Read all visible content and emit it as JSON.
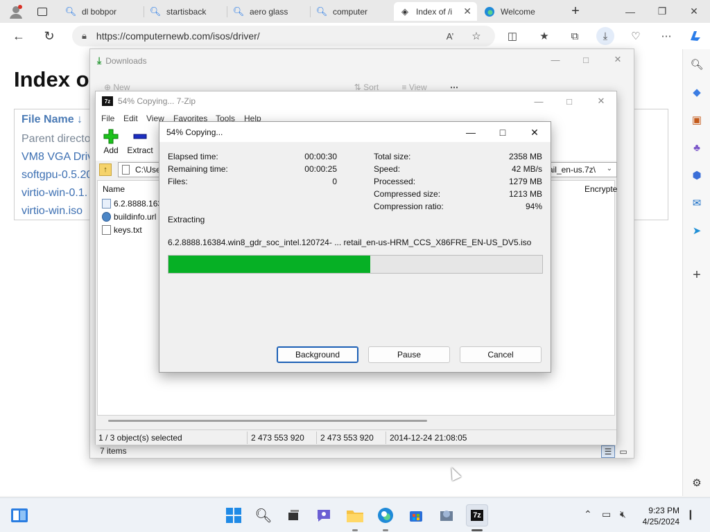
{
  "browser": {
    "tabs": [
      {
        "label": "dl bobpor",
        "icon": "search-icon"
      },
      {
        "label": "startisback",
        "icon": "search-icon"
      },
      {
        "label": "aero glass",
        "icon": "search-icon"
      },
      {
        "label": "computer",
        "icon": "search-icon"
      },
      {
        "label": "Index of /i",
        "icon": "site-icon"
      },
      {
        "label": "Welcome",
        "icon": "edge-icon"
      }
    ],
    "url": "https://computernewb.com/isos/driver/",
    "colors": {
      "accent": "#1a73e8",
      "tab_active": "#ffffff",
      "tab_strip": "#e9e9e9"
    }
  },
  "page": {
    "title": "Index o",
    "column_header": "File Name ↓",
    "rows": [
      "Parent directo",
      "VM8 VGA Driv",
      "softgpu-0.5.20",
      "virtio-win-0.1.",
      "virtio-win.iso"
    ]
  },
  "downloads": {
    "title": "Downloads",
    "new_label": "New",
    "sort_label": "Sort",
    "view_label": "View",
    "status": "7 items"
  },
  "zip": {
    "title": "54% Copying... 7-Zip",
    "logo": "7z",
    "menu": [
      "File",
      "Edit",
      "View",
      "Favorites",
      "Tools",
      "Help"
    ],
    "tools": {
      "add": "Add",
      "extract": "Extract"
    },
    "path_left": "C:\\Use",
    "path_right": "ail_en-us.7z\\",
    "columns": {
      "name": "Name",
      "encrypted": "Encrypte"
    },
    "files": [
      "6.2.8888.1638",
      "buildinfo.url",
      "keys.txt"
    ],
    "status": {
      "selected": "1 / 3 object(s) selected",
      "size": "2 473 553 920",
      "packed": "2 473 553 920",
      "modified": "2014-12-24 21:08:05"
    }
  },
  "progress": {
    "title": "54% Copying...",
    "labels": {
      "elapsed": "Elapsed time:",
      "remaining": "Remaining time:",
      "files": "Files:",
      "total_size": "Total size:",
      "speed": "Speed:",
      "processed": "Processed:",
      "compressed_size": "Compressed size:",
      "compression_ratio": "Compression ratio:"
    },
    "values": {
      "elapsed": "00:00:30",
      "remaining": "00:00:25",
      "files": "0",
      "total_size": "2358 MB",
      "speed": "42 MB/s",
      "processed": "1279 MB",
      "compressed_size": "1213 MB",
      "compression_ratio": "94%"
    },
    "operation": "Extracting",
    "current_file": "6.2.8888.16384.win8_gdr_soc_intel.120724- ... retail_en-us-HRM_CCS_X86FRE_EN-US_DV5.iso",
    "percent": 54,
    "bar_color": "#06b025",
    "buttons": {
      "background": "Background",
      "pause": "Pause",
      "cancel": "Cancel"
    }
  },
  "taskbar": {
    "time": "9:23 PM",
    "date": "4/25/2024"
  }
}
